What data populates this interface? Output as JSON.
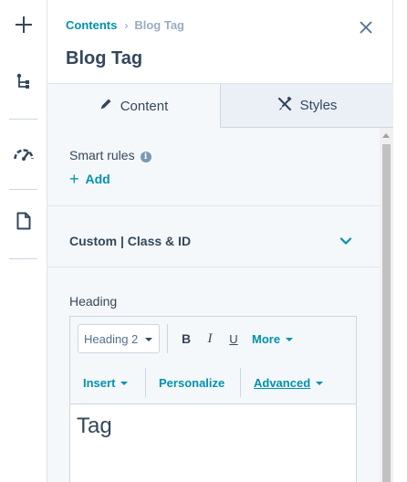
{
  "rail": {
    "icons": [
      "plus-icon",
      "tree-icon",
      "speedometer-icon",
      "document-icon"
    ]
  },
  "panel": {
    "breadcrumb": {
      "parent": "Contents",
      "separator": "›",
      "current": "Blog Tag"
    },
    "title": "Blog Tag",
    "tabs": [
      {
        "label": "Content",
        "icon": "pencil-icon",
        "active": true
      },
      {
        "label": "Styles",
        "icon": "styles-icon",
        "active": false
      }
    ],
    "smart_rules": {
      "label": "Smart rules",
      "info_glyph": "i",
      "add_label": "Add",
      "add_icon": "+"
    },
    "custom_class": {
      "label": "Custom | Class & ID"
    },
    "heading_field": {
      "label": "Heading",
      "format_value": "Heading 2",
      "toolbar": {
        "bold": "B",
        "italic": "I",
        "underline": "U",
        "more": "More",
        "insert": "Insert",
        "personalize": "Personalize",
        "advanced": "Advanced"
      },
      "content": "Tag"
    }
  },
  "colors": {
    "link": "#0091ae",
    "text": "#33475b",
    "muted": "#99acc2",
    "panel_bg": "#f5f8fa",
    "border": "#cbd6e2"
  }
}
